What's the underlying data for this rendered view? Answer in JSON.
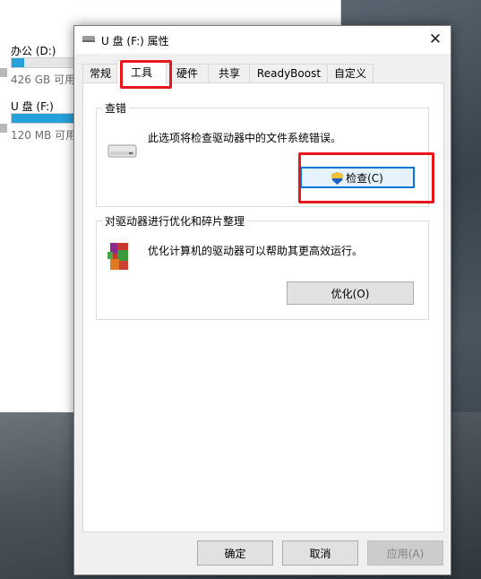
{
  "explorer": {
    "drives": [
      {
        "name": "办公 (D:)",
        "size": "426 GB 可用",
        "fill": 0.2
      },
      {
        "name": "U 盘 (F:)",
        "size": "120 MB 可用",
        "fill": 0.99
      }
    ]
  },
  "dialog": {
    "title": "U 盘 (F:) 属性",
    "close_glyph": "✕",
    "tabs": [
      "常规",
      "工具",
      "硬件",
      "共享",
      "ReadyBoost",
      "自定义"
    ],
    "active_tab": "工具",
    "error_check": {
      "title": "查错",
      "description": "此选项将检查驱动器中的文件系统错误。",
      "button": "检查(C)"
    },
    "optimize": {
      "title": "对驱动器进行优化和碎片整理",
      "description": "优化计算机的驱动器可以帮助其更高效运行。",
      "button": "优化(O)"
    },
    "buttons": {
      "ok": "确定",
      "cancel": "取消",
      "apply": "应用(A)"
    }
  },
  "colors": {
    "highlight": "#e8171e",
    "accent": "#0078d7",
    "drive_fill": "#26a0da"
  }
}
